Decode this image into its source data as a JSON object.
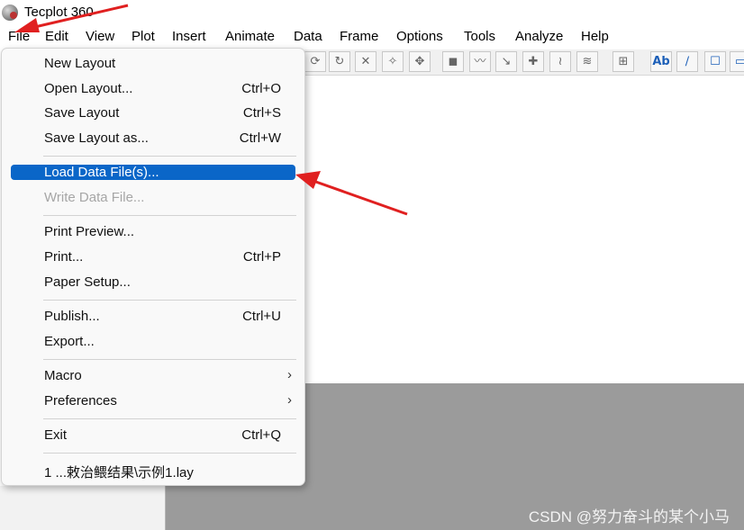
{
  "app": {
    "title": "Tecplot 360"
  },
  "menubar": [
    {
      "id": "file",
      "label": "File"
    },
    {
      "id": "edit",
      "label": "Edit"
    },
    {
      "id": "view",
      "label": "View"
    },
    {
      "id": "plot",
      "label": "Plot"
    },
    {
      "id": "insert",
      "label": "Insert"
    },
    {
      "id": "animate",
      "label": "Animate"
    },
    {
      "id": "data",
      "label": "Data"
    },
    {
      "id": "frame",
      "label": "Frame"
    },
    {
      "id": "options",
      "label": "Options"
    },
    {
      "id": "tools",
      "label": "Tools"
    },
    {
      "id": "analyze",
      "label": "Analyze"
    },
    {
      "id": "help",
      "label": "Help"
    }
  ],
  "toolbar": {
    "text_tool_label": "Ab",
    "icons": [
      "rotate-icon",
      "rotate-3d-icon",
      "zoom-xy-icon",
      "zoom-y-icon",
      "translate-icon",
      "probe-icon",
      "slice-icon",
      "streamtrace-icon",
      "contour-add-icon",
      "contour-remove-icon",
      "contour-edit-icon",
      "axis-icon",
      "text-tool-icon",
      "polyline-icon",
      "rectangle-icon",
      "square-icon"
    ]
  },
  "file_menu": {
    "items": [
      {
        "label": "New Layout",
        "shortcut": ""
      },
      {
        "label": "Open Layout...",
        "shortcut": "Ctrl+O"
      },
      {
        "label": "Save Layout",
        "shortcut": "Ctrl+S"
      },
      {
        "label": "Save Layout as...",
        "shortcut": "Ctrl+W"
      },
      {
        "label": "Load Data File(s)...",
        "shortcut": "",
        "state": "highlighted"
      },
      {
        "label": "Write Data File...",
        "shortcut": "",
        "state": "disabled"
      },
      {
        "label": "Print Preview...",
        "shortcut": ""
      },
      {
        "label": "Print...",
        "shortcut": "Ctrl+P"
      },
      {
        "label": "Paper Setup...",
        "shortcut": ""
      },
      {
        "label": "Publish...",
        "shortcut": "Ctrl+U"
      },
      {
        "label": "Export...",
        "shortcut": ""
      },
      {
        "label": "Macro",
        "submenu": true
      },
      {
        "label": "Preferences",
        "submenu": true
      },
      {
        "label": "Exit",
        "shortcut": "Ctrl+Q"
      },
      {
        "label": "1 ...敕治鳂结果\\示例1.lay",
        "shortcut": ""
      }
    ],
    "submenu_glyph": "›"
  },
  "annotations": {
    "arrow_color": "#e02020"
  },
  "watermark": "CSDN @努力奋斗的某个小马"
}
